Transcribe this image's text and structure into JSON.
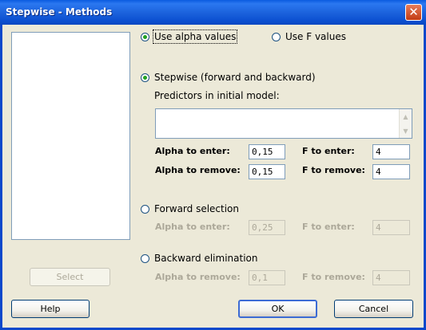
{
  "window": {
    "title": "Stepwise - Methods"
  },
  "list": {
    "select_label": "Select"
  },
  "values_type": {
    "alpha_label": "Use alpha values",
    "f_label": "Use F values",
    "selected": "alpha"
  },
  "stepwise": {
    "label": "Stepwise (forward and backward)",
    "predictors_label": "Predictors in initial model:",
    "predictors_value": "",
    "alpha_enter_label": "Alpha to enter:",
    "alpha_enter_value": "0,15",
    "f_enter_label": "F to enter:",
    "f_enter_value": "4",
    "alpha_remove_label": "Alpha to remove:",
    "alpha_remove_value": "0,15",
    "f_remove_label": "F to remove:",
    "f_remove_value": "4"
  },
  "forward": {
    "label": "Forward selection",
    "alpha_enter_label": "Alpha to enter:",
    "alpha_enter_value": "0,25",
    "f_enter_label": "F to enter:",
    "f_enter_value": "4"
  },
  "backward": {
    "label": "Backward elimination",
    "alpha_remove_label": "Alpha to remove:",
    "alpha_remove_value": "0,1",
    "f_remove_label": "F to remove:",
    "f_remove_value": "4"
  },
  "buttons": {
    "help": "Help",
    "ok": "OK",
    "cancel": "Cancel"
  },
  "icons": {
    "close": "close-icon",
    "scroll_up": "scroll-up-icon",
    "scroll_down": "scroll-down-icon"
  },
  "colors": {
    "titlebar": "#0A5BE0",
    "face": "#ECE9D8",
    "radio_dot": "#21A121",
    "close": "#C23C14"
  }
}
